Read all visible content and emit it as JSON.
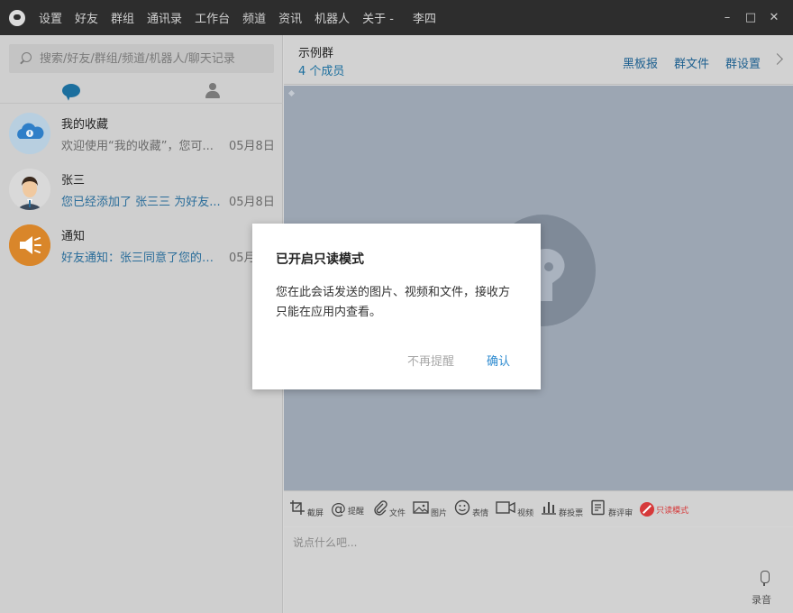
{
  "titlebar": {
    "menu": [
      "设置",
      "好友",
      "群组",
      "通讯录",
      "工作台",
      "频道",
      "资讯",
      "机器人",
      "关于 -"
    ],
    "user": "李四",
    "controls": [
      "minimize-icon",
      "maximize-icon",
      "close-icon"
    ]
  },
  "sidebar": {
    "search_placeholder": "搜索/好友/群组/频道/机器人/聊天记录",
    "tabs": [
      "chat-bubble-icon",
      "contacts-icon"
    ],
    "conversations": [
      {
        "name": "我的收藏",
        "preview": "欢迎使用“我的收藏”，您可...",
        "date": "05月8日",
        "avatar": "cloud-avatar"
      },
      {
        "name": "张三",
        "preview": "您已经添加了 张三三  为好友...",
        "date": "05月8日",
        "avatar": "person-avatar"
      },
      {
        "name": "通知",
        "preview": "好友通知：张三同意了您的好...",
        "date": "05月",
        "avatar": "speaker-avatar"
      }
    ]
  },
  "chat": {
    "group_name": "示例群",
    "member_count": "4 个成员",
    "header_links": [
      "黑板报",
      "群文件",
      "群设置"
    ],
    "toolbar": [
      {
        "icon": "crop-icon",
        "label": "截屏"
      },
      {
        "icon": "at-icon",
        "label": "提醒"
      },
      {
        "icon": "paperclip-icon",
        "label": "文件"
      },
      {
        "icon": "image-icon",
        "label": "图片"
      },
      {
        "icon": "emoji-icon",
        "label": "表情"
      },
      {
        "icon": "video-icon",
        "label": "视频"
      },
      {
        "icon": "poll-icon",
        "label": "群投票"
      },
      {
        "icon": "review-icon",
        "label": "群评审"
      },
      {
        "icon": "readonly-icon",
        "label": "只读模式"
      }
    ],
    "input_placeholder": "说点什么吧...",
    "record_label": "录音"
  },
  "dialog": {
    "title": "已开启只读模式",
    "body": "您在此会话发送的图片、视频和文件，接收方只能在应用内查看。",
    "dismiss_label": "不再提醒",
    "confirm_label": "确认"
  },
  "colors": {
    "titlebar_bg": "#2d2d2d",
    "accent_blue": "#1c6f9e",
    "confirm_blue": "#2e8bd0",
    "readonly_red": "#d6393a",
    "chat_bg": "#9ca6b3"
  }
}
